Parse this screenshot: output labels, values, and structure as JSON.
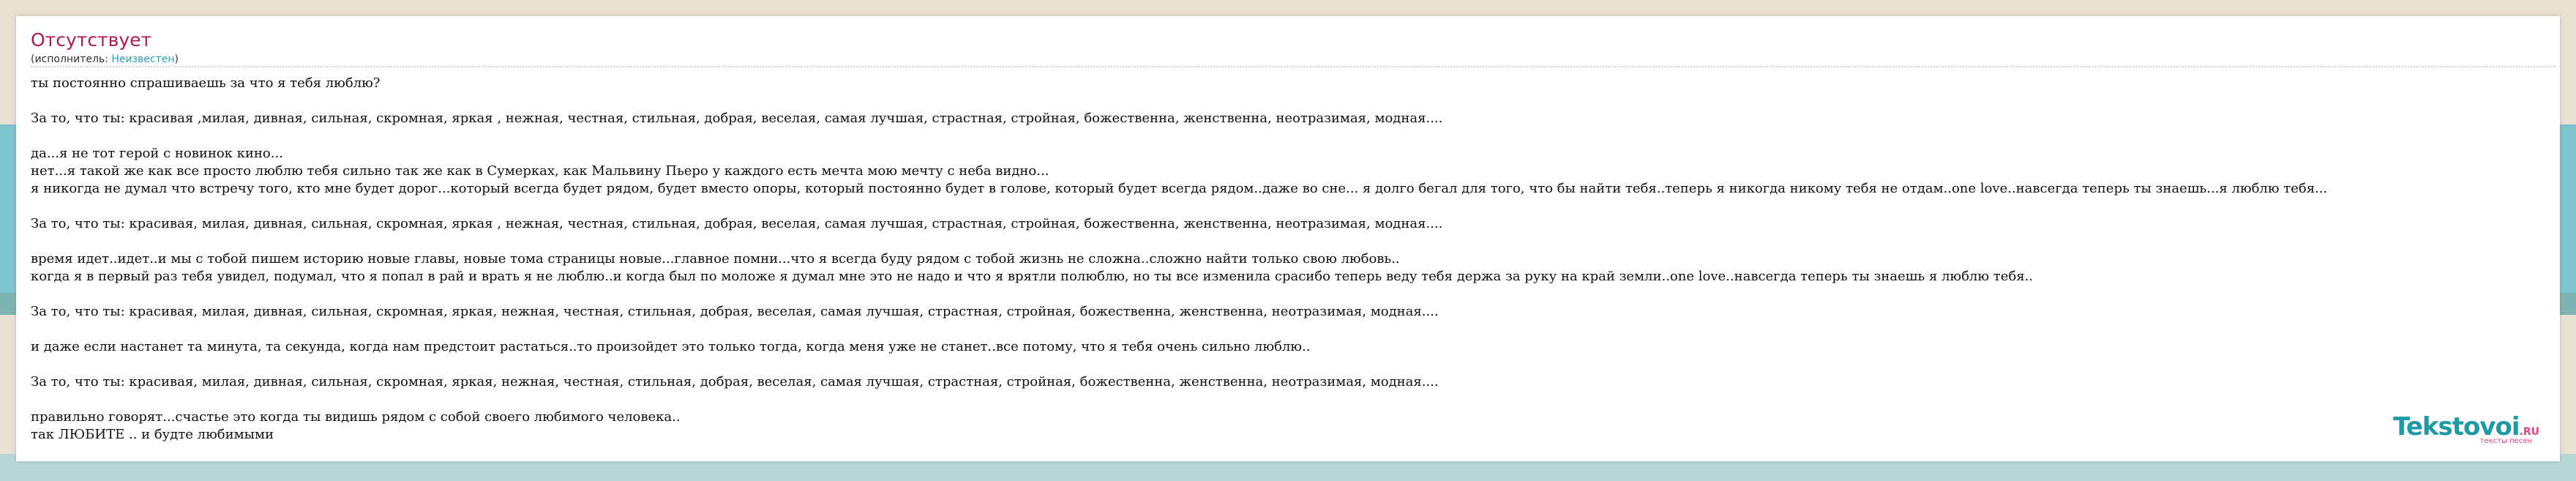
{
  "song": {
    "title": "Отсутствует",
    "performer_prefix": "(исполнитель: ",
    "performer_name": "Неизвестен",
    "performer_suffix": ")"
  },
  "lyrics": [
    "ты постоянно спрашиваешь за что я тебя люблю?",
    "",
    "За то, что ты: красивая ,милая, дивная, сильная, скромная, яркая , нежная, честная, стильная, добрая, веселая, самая лучшая, страстная, стройная, божественна, женственна, неотразимая, модная....",
    "",
    "да...я не тот герой с новинок кино...",
    "нет...я такой же как все просто люблю тебя сильно так же как в Сумерках, как Мальвину Пьеро у каждого есть мечта мою мечту с неба видно...",
    "я никогда не думал что встречу того, кто мне будет дорог...который всегда будет рядом, будет вместо опоры, который постоянно будет в голове, который будет всегда рядом..даже во сне... я долго бегал для того, что бы найти тебя..теперь я никогда никому тебя не отдам..one love..навсегда теперь ты знаешь...я люблю тебя...",
    "",
    "За то, что ты: красивая, милая, дивная, сильная, скромная, яркая , нежная, честная, стильная, добрая, веселая, самая лучшая, страстная, стройная, божественна, женственна, неотразимая, модная....",
    "",
    "время идет..идет..и мы с тобой пишем историю новые главы, новые тома страницы новые...главное помни...что я всегда буду рядом с тобой жизнь не сложна..сложно найти только свою любовь..",
    "когда я в первый раз тебя увидел, подумал, что я попал в рай и врать я не люблю..и когда был по моложе я думал мне это не надо и что я врятли полюблю, но ты все изменила сраcибо теперь веду тебя держа за руку на край земли..one love..навсегда теперь ты знаешь я люблю тебя..",
    "",
    "За то, что ты: красивая, милая, дивная, сильная, скромная, яркая, нежная, честная, стильная, добрая, веселая, самая лучшая, страстная, стройная, божественна, женственна, неотразимая, модная....",
    "",
    "и даже если настанет та минута, та секунда, когда нам предстоит растаться..то произойдет это только тогда, когда меня уже не станет..все потому, что я тебя очень сильно люблю..",
    "",
    "За то, что ты: красивая, милая, дивная, сильная, скромная, яркая, нежная, честная, стильная, добрая, веселая, самая лучшая, страстная, стройная, божественна, женственна, неотразимая, модная....",
    "",
    "правильно говорят...счастье это когда ты видишь рядом с собой своего любимого человека..",
    "так ЛЮБИТЕ .. и будте любимыми"
  ],
  "logo": {
    "word": "Tekstovoi",
    "tld": ".RU",
    "tagline": "тексты песен"
  }
}
